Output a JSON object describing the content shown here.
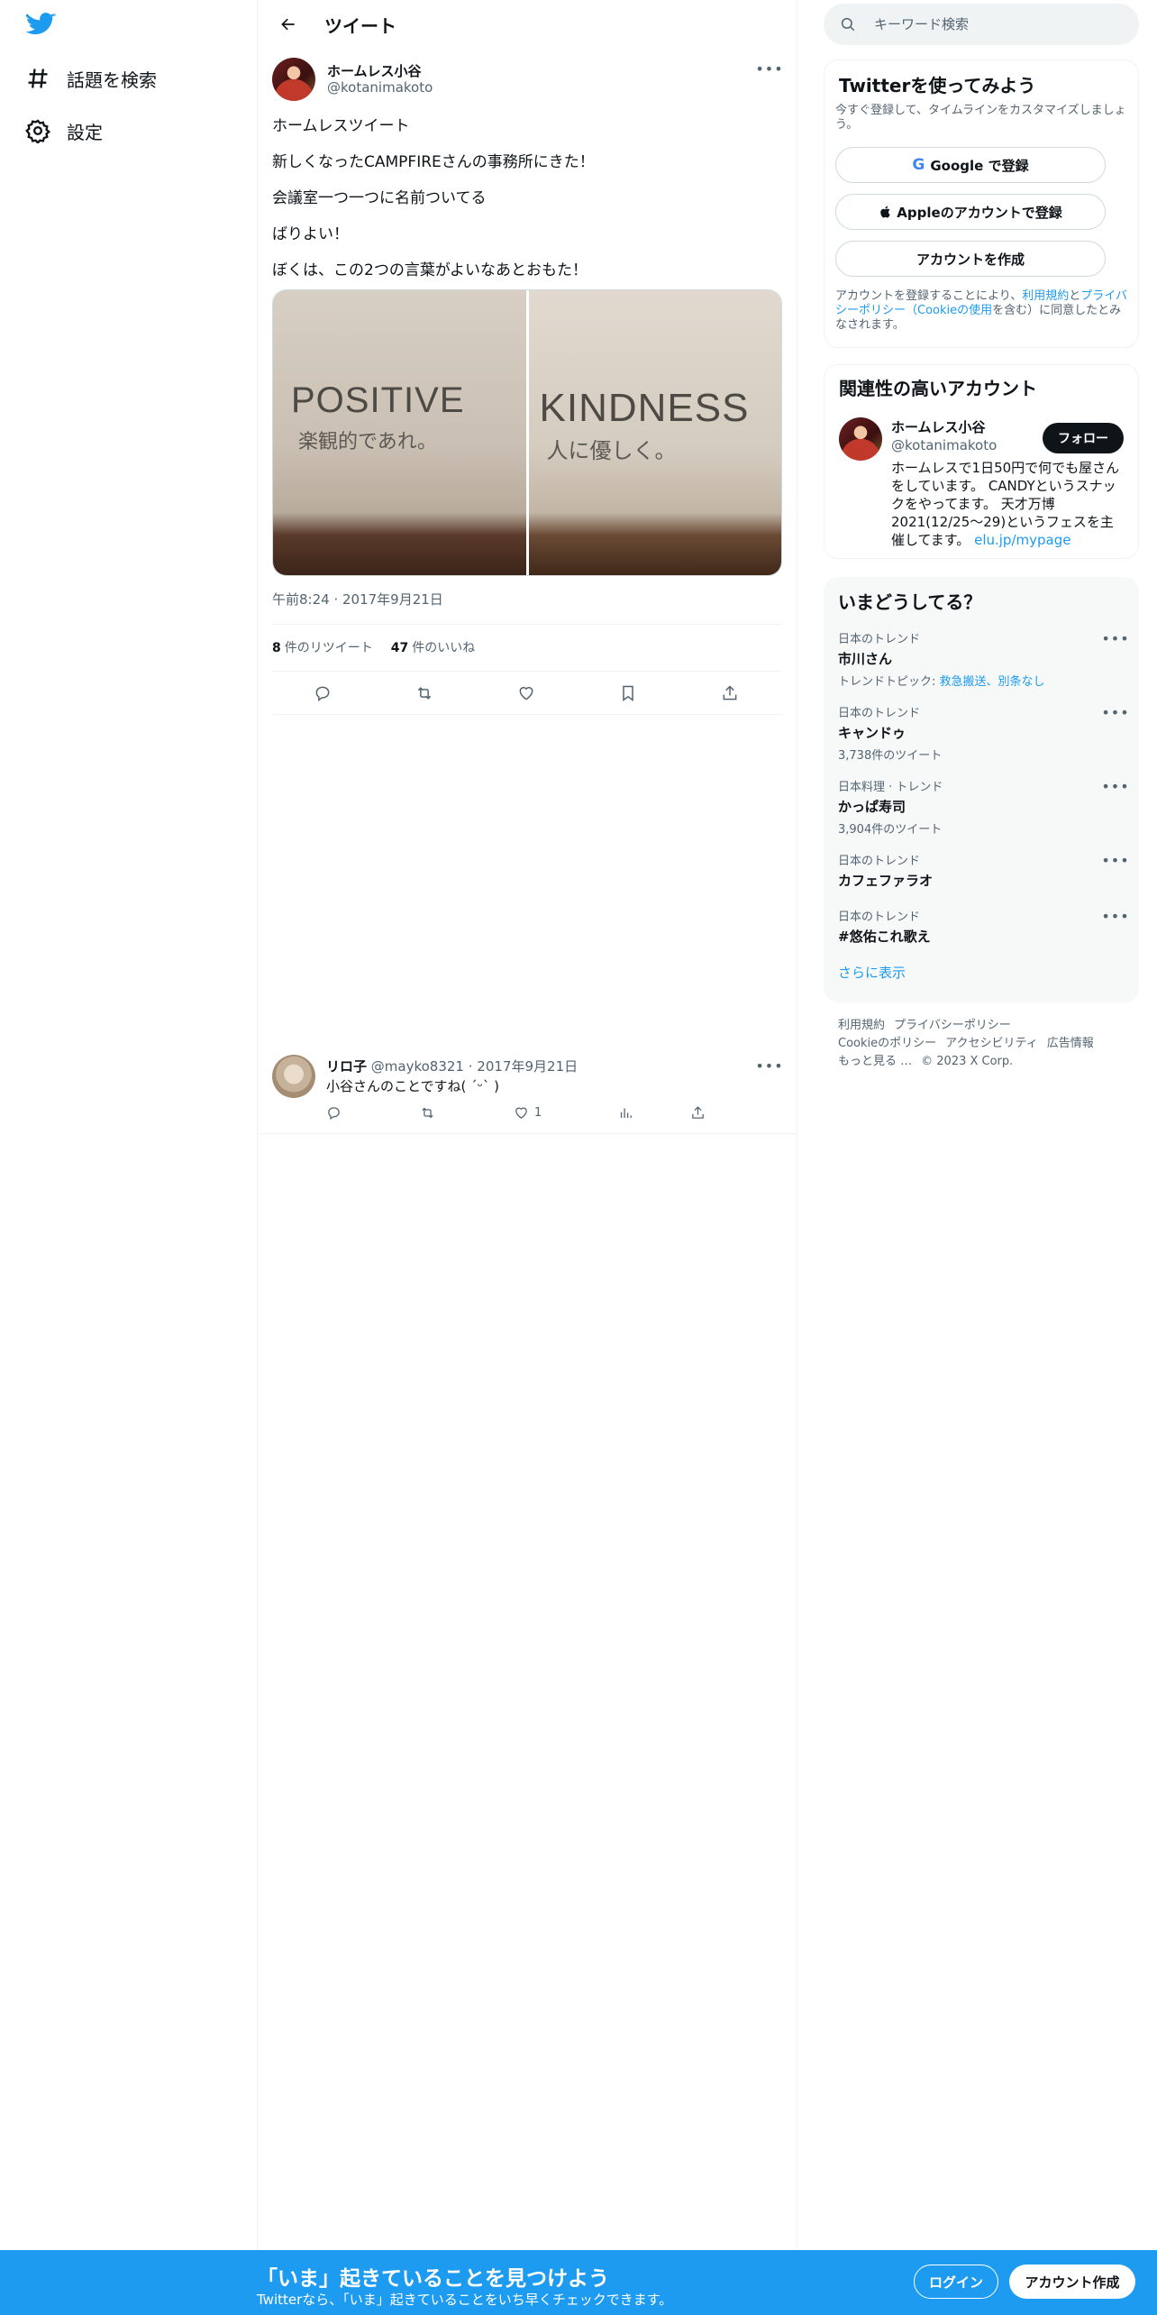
{
  "nav": {
    "logo": "twitter-bird-icon",
    "items": [
      {
        "label": "話題を検索",
        "icon": "hashtag-icon"
      },
      {
        "label": "設定",
        "icon": "gear-icon"
      }
    ]
  },
  "header": {
    "title": "ツイート",
    "back_icon": "arrow-left-icon"
  },
  "tweet": {
    "author_name": "ホームレス小谷",
    "author_handle": "@kotanimakoto",
    "lines": [
      "ホームレスツイート",
      "新しくなったCAMPFIREさんの事務所にきた！",
      "会議室一つ一つに名前ついてる",
      "ばりよい！",
      "ぼくは、この2つの言葉がよいなあとおもた！"
    ],
    "photos": [
      {
        "word": "POSITIVE",
        "caption": "楽観的であれ。"
      },
      {
        "word": "KINDNESS",
        "caption": "人に優しく。"
      }
    ],
    "timestamp": "午前8:24 · 2017年9月21日",
    "retweets": "8",
    "retweets_label": "件のリツイート",
    "likes": "47",
    "likes_label": "件のいいね"
  },
  "reply": {
    "name": "リロ子",
    "handle": "@mayko8321",
    "date": "· 2017年9月21日",
    "text": "小谷さんのことですね( ˊᵕˋ )",
    "like_count": "1"
  },
  "search": {
    "placeholder": "キーワード検索"
  },
  "signup": {
    "title": "Twitterを使ってみよう",
    "subtitle": "今すぐ登録して、タイムラインをカスタマイズしましょう。",
    "google": "Google で登録",
    "apple": "Appleのアカウントで登録",
    "create": "アカウントを作成",
    "terms_1": "アカウントを登録することにより、",
    "terms_link1": "利用規約",
    "terms_2": "と",
    "terms_link2": "プライバシーポリシー（Cookieの使用",
    "terms_3": "を含む）に同意したとみなされます。"
  },
  "related": {
    "title": "関連性の高いアカウント",
    "name": "ホームレス小谷",
    "handle": "@kotanimakoto",
    "follow": "フォロー",
    "bio": "ホームレスで1日50円で何でも屋さんをしています。 CANDYというスナックをやってます。 天才万博2021(12/25〜29)というフェスを主催してます。",
    "bio_link": "elu.jp/mypage"
  },
  "trends": {
    "title": "いまどうしてる？",
    "items": [
      {
        "context": "日本のトレンド",
        "name": "市川さん",
        "sub_prefix": "トレンドトピック: ",
        "sub_link": "救急搬送、別条なし"
      },
      {
        "context": "日本のトレンド",
        "name": "キャンドゥ",
        "sub": "3,738件のツイート"
      },
      {
        "context": "日本料理 · トレンド",
        "name": "かっぱ寿司",
        "sub": "3,904件のツイート"
      },
      {
        "context": "日本のトレンド",
        "name": "カフェファラオ"
      },
      {
        "context": "日本のトレンド",
        "name": "#悠佑これ歌え"
      }
    ],
    "show_more": "さらに表示"
  },
  "footer": {
    "row1": [
      "利用規約",
      "プライバシーポリシー"
    ],
    "row2": [
      "Cookieのポリシー",
      "アクセシビリティ",
      "広告情報"
    ],
    "row3": [
      "もっと見る …",
      "© 2023 X Corp."
    ]
  },
  "banner": {
    "title": "「いま」起きていることを見つけよう",
    "subtitle": "Twitterなら、「いま」起きていることをいち早くチェックできます。",
    "login": "ログイン",
    "signup": "アカウント作成"
  },
  "colors": {
    "accent": "#1d9bf0",
    "text": "#0f1419",
    "muted": "#536471"
  }
}
